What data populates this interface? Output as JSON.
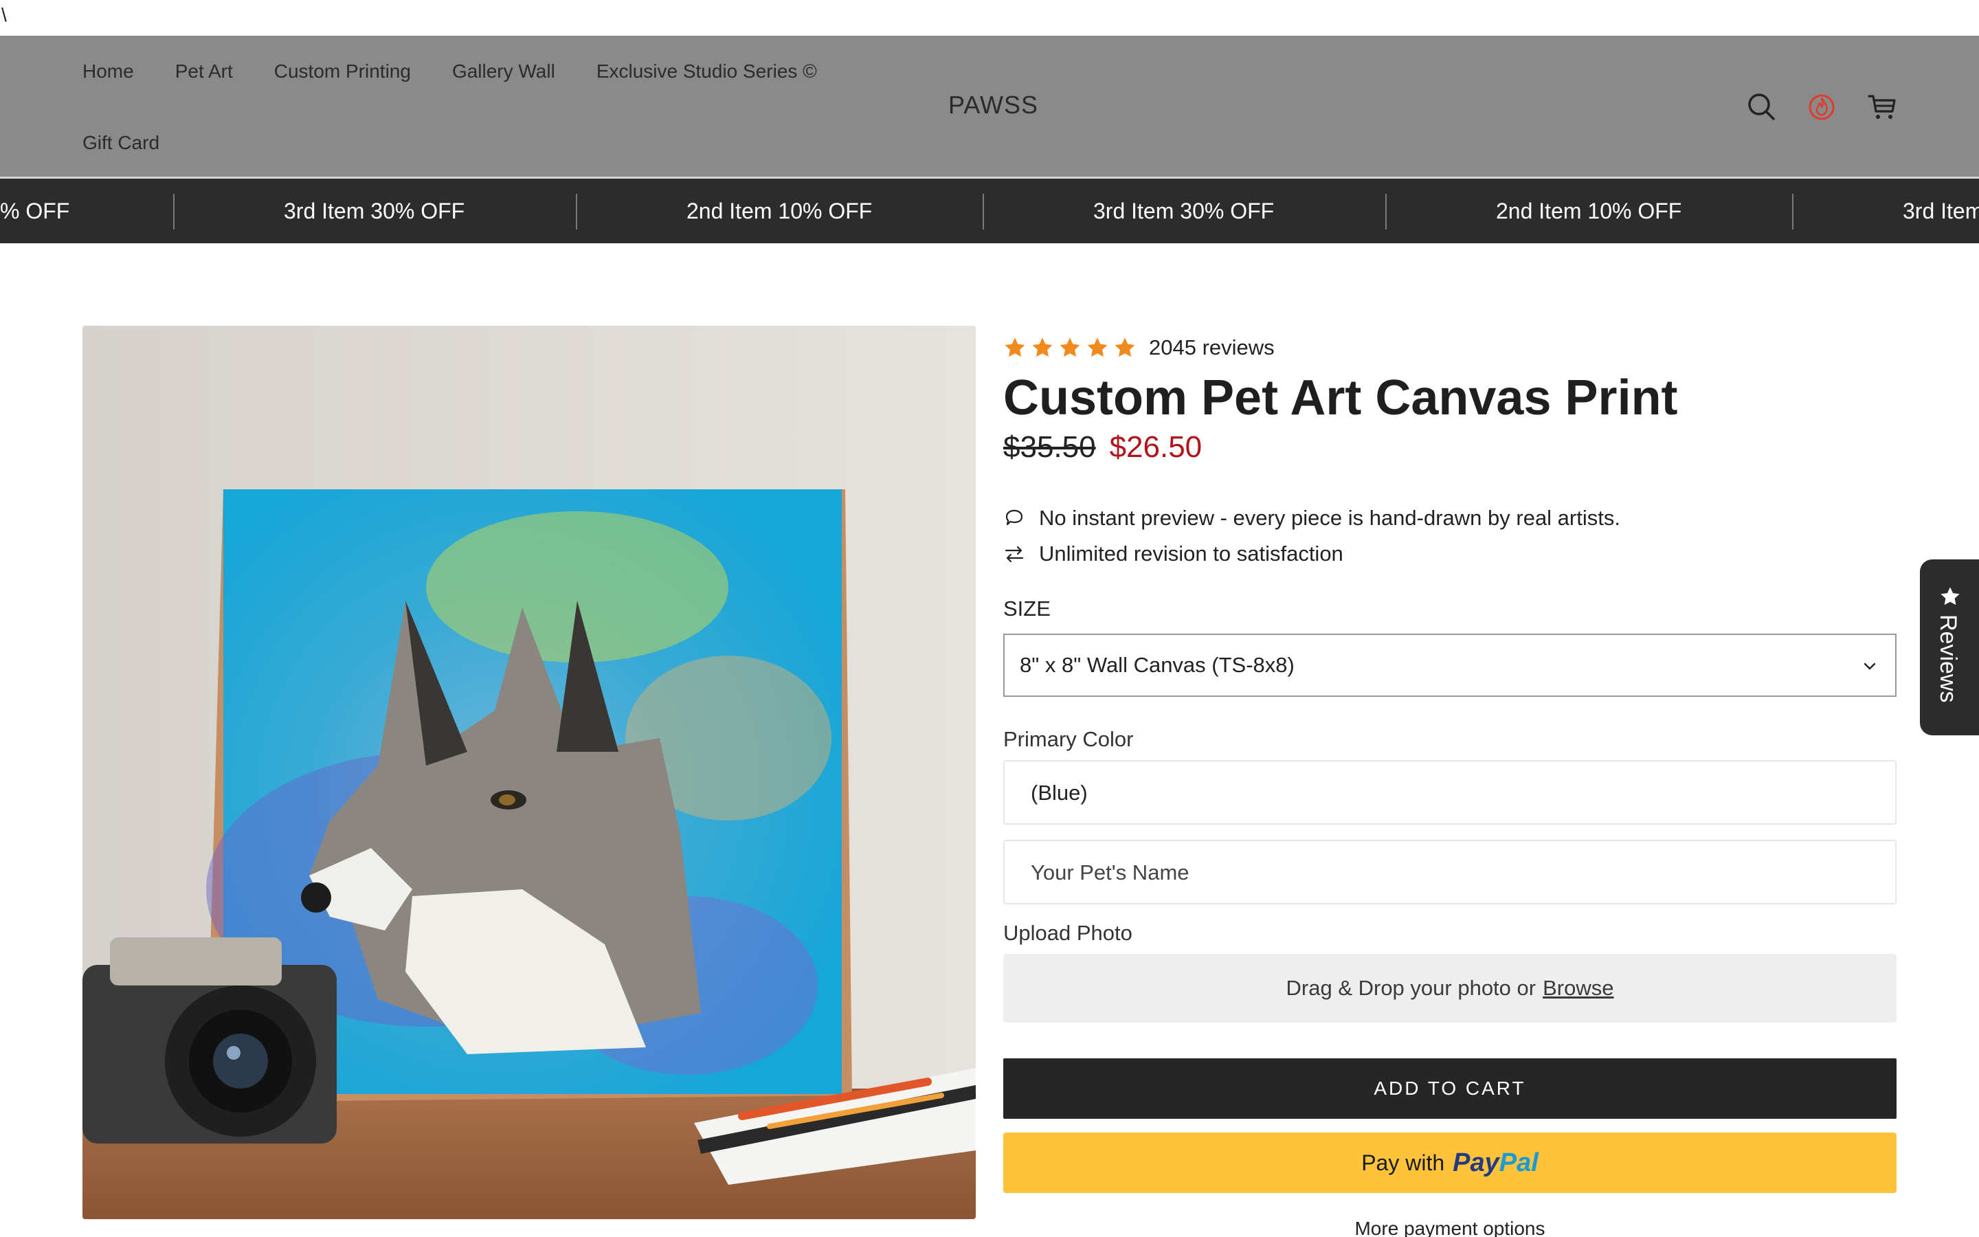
{
  "top_strip": {
    "mark": "\\"
  },
  "header": {
    "nav": {
      "row1": [
        "Home",
        "Pet Art",
        "Custom Printing",
        "Gallery Wall",
        "Exclusive Studio Series ©"
      ],
      "row2": [
        "Gift Card"
      ]
    },
    "logo": "PAWSS",
    "icons": [
      "search-icon",
      "rewards-flame-icon",
      "cart-icon"
    ],
    "rewards_icon_color": "#e23b2e"
  },
  "promo_bar": {
    "items": [
      "% OFF",
      "3rd Item 30% OFF",
      "2nd Item 10% OFF",
      "3rd Item 30% OFF",
      "2nd Item 10% OFF",
      "3rd Item"
    ]
  },
  "product": {
    "image_alt": "Custom painted husky portrait canvas leaning on wall behind a vintage camera and notebook on a wooden table",
    "rating": {
      "stars": 5,
      "reviews_label": "2045 reviews",
      "star_color": "#f08a1c"
    },
    "title": "Custom Pet Art Canvas Print",
    "price_original": "$35.50",
    "price_sale": "$26.50",
    "sale_color": "#b3121b",
    "features": [
      {
        "icon": "speech-bubble-icon",
        "text": "No instant preview - every piece is hand-drawn by real artists."
      },
      {
        "icon": "swap-arrows-icon",
        "text": "Unlimited revision to satisfaction"
      }
    ],
    "size": {
      "label": "SIZE",
      "selected": "8\" x 8\" Wall Canvas (TS-8x8)"
    },
    "primary_color": {
      "label": "Primary Color",
      "value": "(Blue)"
    },
    "pet_name": {
      "placeholder": "Your Pet's Name",
      "value": ""
    },
    "upload": {
      "label": "Upload Photo",
      "text": "Drag & Drop your photo or",
      "browse": "Browse"
    },
    "add_to_cart": "ADD TO CART",
    "paypal": {
      "prefix": "Pay with",
      "brand_a": "Pay",
      "brand_b": "Pal"
    },
    "more_payment": "More payment options"
  },
  "reviews_tab": {
    "label": "Reviews"
  }
}
